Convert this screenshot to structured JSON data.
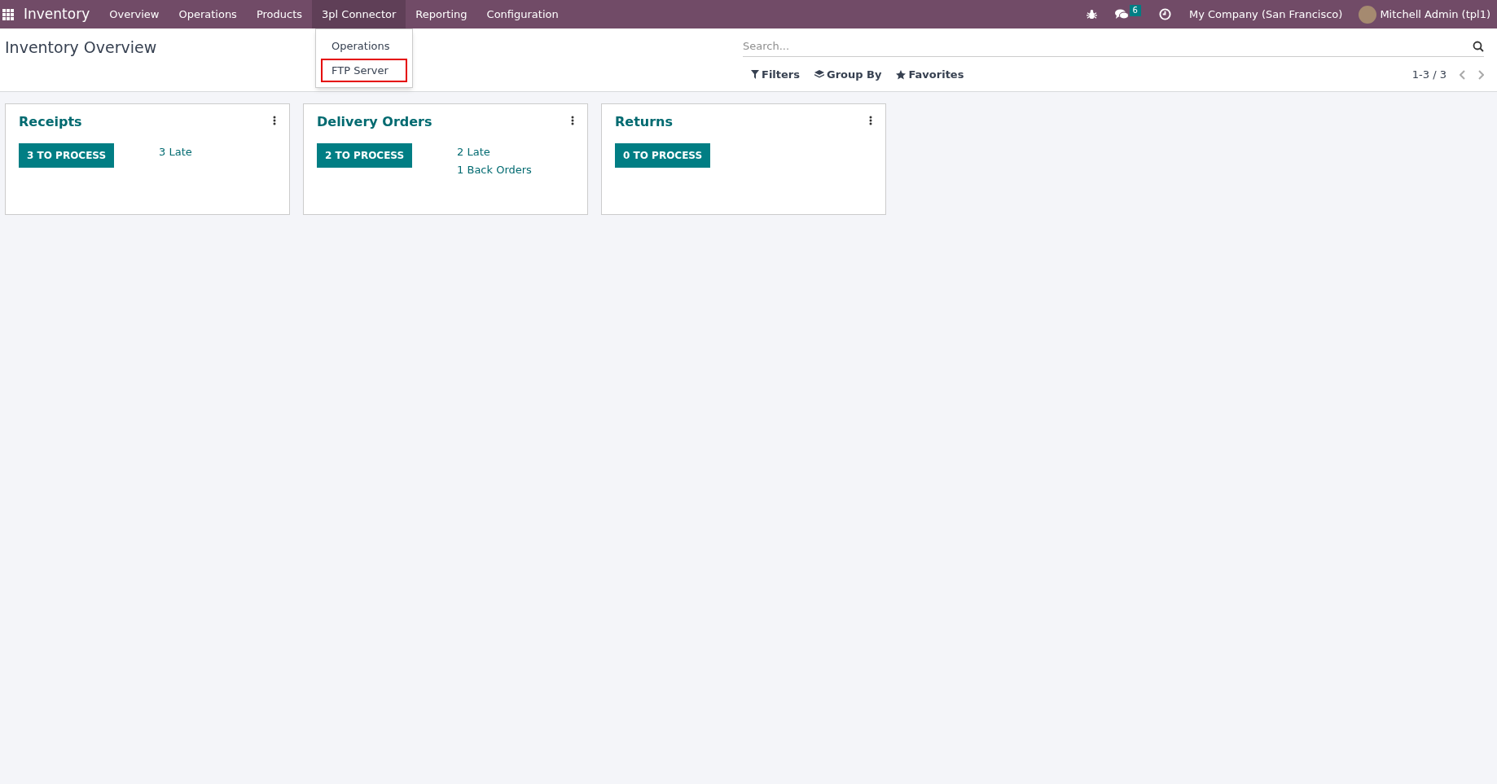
{
  "navbar": {
    "app_name": "Inventory",
    "menu": [
      {
        "label": "Overview",
        "selected": false
      },
      {
        "label": "Operations",
        "selected": false
      },
      {
        "label": "Products",
        "selected": false
      },
      {
        "label": "3pl Connector",
        "selected": true
      },
      {
        "label": "Reporting",
        "selected": false
      },
      {
        "label": "Configuration",
        "selected": false
      }
    ],
    "dropdown": [
      {
        "label": "Operations",
        "highlighted": false
      },
      {
        "label": "FTP Server",
        "highlighted": true
      }
    ],
    "message_count": "6",
    "company": "My Company (San Francisco)",
    "user": "Mitchell Admin (tpl1)"
  },
  "control_panel": {
    "title": "Inventory Overview",
    "search": {
      "placeholder": "Search..."
    },
    "filters": [
      "Filters",
      "Group By",
      "Favorites"
    ],
    "pager": "1-3 / 3"
  },
  "cards": [
    {
      "title": "Receipts",
      "button": "3 TO PROCESS",
      "links": [
        "3 Late"
      ]
    },
    {
      "title": "Delivery Orders",
      "button": "2 TO PROCESS",
      "links": [
        "2 Late",
        "1 Back Orders"
      ]
    },
    {
      "title": "Returns",
      "button": "0 TO PROCESS"
    }
  ]
}
